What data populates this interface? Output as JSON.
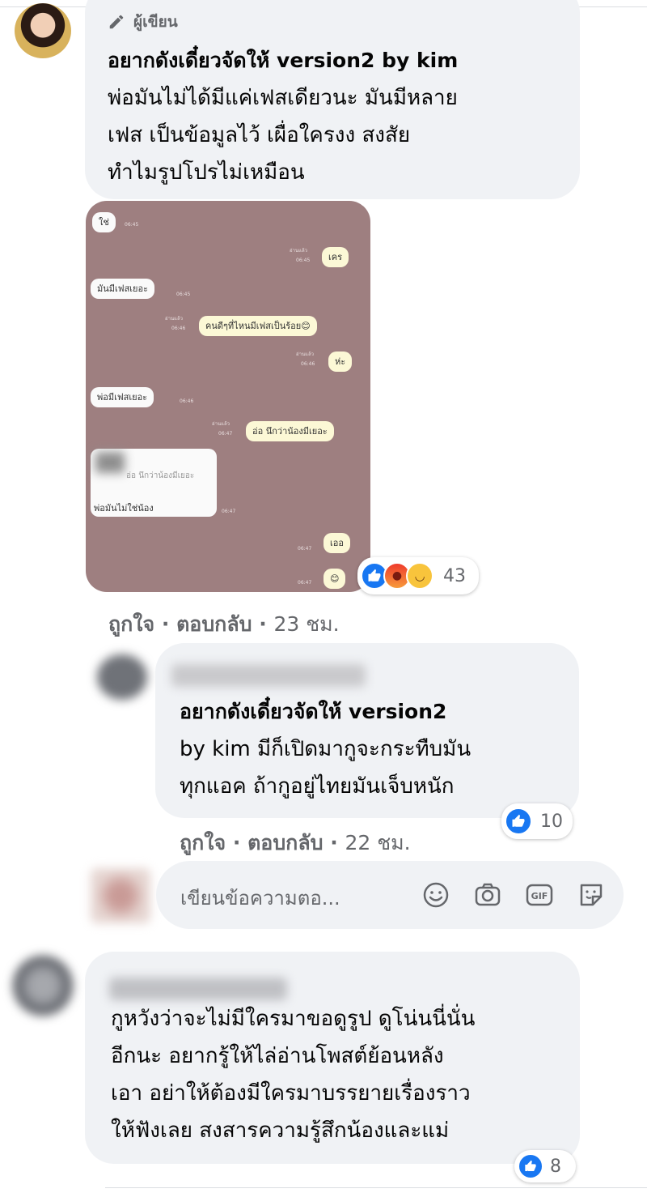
{
  "comment1": {
    "badge": "ผู้เขียน",
    "author": "อยากดังเดี๋ยวจัดให้ version2 by kim",
    "lines": [
      "พ่อมันไม่ได้มีแค่เฟสเดียวนะ มันมีหลาย",
      "เฟส เป็นข้อมูลไว้ เผื่อใครงง สงสัย",
      "ทำไมรูปโปรไม่เหมือน"
    ],
    "attachment": {
      "messages": [
        {
          "side": "left",
          "text": "ใช่",
          "time": "06:45"
        },
        {
          "side": "right",
          "read": "อ่านแล้ว",
          "time": "06:45",
          "text": "เคร"
        },
        {
          "side": "left",
          "text": "มันมีเฟสเยอะ",
          "time": "06:45"
        },
        {
          "side": "right",
          "read": "อ่านแล้ว",
          "time": "06:46",
          "text": "คนดีๆที่ไหนมีเฟสเป็นร้อย😊"
        },
        {
          "side": "right",
          "read": "อ่านแล้ว",
          "time": "06:46",
          "text": "ห่ะ"
        },
        {
          "side": "left",
          "text": "พ่อมีเฟสเยอะ",
          "time": "06:46"
        },
        {
          "side": "right",
          "read": "อ่านแล้ว",
          "time": "06:47",
          "text": "อ่อ นึกว่าน้องมีเยอะ"
        },
        {
          "side": "left",
          "quote": "อ่อ นึกว่าน้องมีเยอะ",
          "text": "พ่อมันไม่ใช่น้อง",
          "time": "06:47"
        },
        {
          "side": "right",
          "time": "06:47",
          "text": "เออ"
        },
        {
          "side": "right",
          "time": "06:47",
          "text": "😊"
        }
      ]
    },
    "reactions": {
      "icons": [
        "like-icon",
        "angry-icon",
        "haha-icon"
      ],
      "count": "43"
    },
    "like": "ถูกใจ",
    "reply": "ตอบกลับ",
    "time": "23 ชม."
  },
  "reply1": {
    "author": "อยากดังเดี๋ยวจัดให้ version2",
    "lines": [
      "by kim มีก็เปิดมากูจะกระทืบมัน",
      "ทุกแอค ถ้ากูอยู่ไทยมันเจ็บหนัก"
    ],
    "reactions": {
      "icons": [
        "like-icon"
      ],
      "count": "10"
    },
    "like": "ถูกใจ",
    "reply": "ตอบกลับ",
    "time": "22 ชม."
  },
  "composer": {
    "placeholder": "เขียนข้อความตอ...",
    "icons": [
      "emoji-icon",
      "camera-icon",
      "gif-icon",
      "sticker-icon"
    ]
  },
  "comment2": {
    "lines": [
      "กูหวังว่าจะไม่มีใครมาขอดูรูป ดูโน่นนี่นั่น",
      "อีกนะ อยากรู้ให้ไล่อ่านโพสต์ย้อนหลัง",
      "เอา อย่าให้ต้องมีใครมาบรรยายเรื่องราว",
      "ให้ฟังเลย สงสารความรู้สึกน้องและแม่"
    ],
    "reactions": {
      "icons": [
        "like-icon"
      ],
      "count": "8"
    }
  },
  "colors": {
    "bubble": "#f0f2f5",
    "secondary_text": "#65676b",
    "like_blue": "#1877f2",
    "chat_background": "#9e7f80"
  }
}
